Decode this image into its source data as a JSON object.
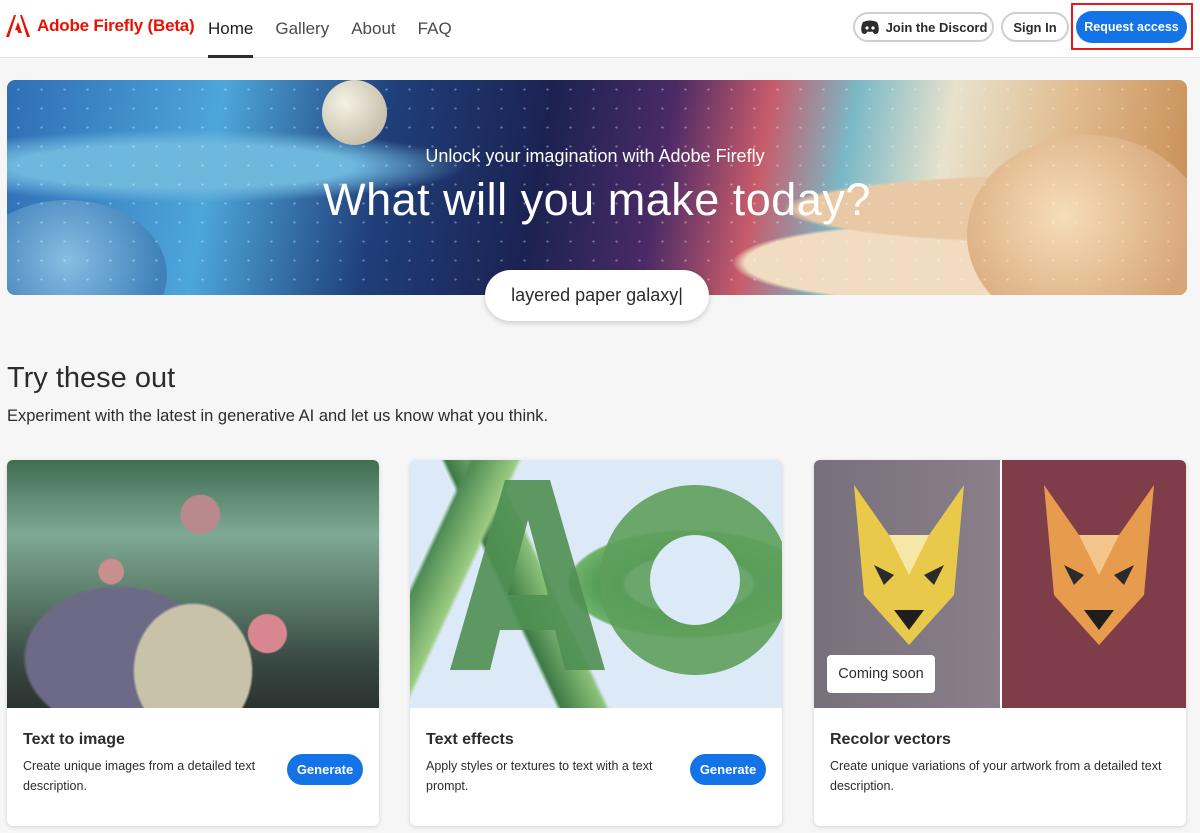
{
  "app": {
    "brand": "Adobe Firefly (Beta)",
    "colors": {
      "accent": "#1473e6",
      "brand": "#eb1000",
      "highlight": "#e8191a"
    }
  },
  "nav": {
    "items": [
      {
        "label": "Home",
        "active": true
      },
      {
        "label": "Gallery",
        "active": false
      },
      {
        "label": "About",
        "active": false
      },
      {
        "label": "FAQ",
        "active": false
      }
    ]
  },
  "header_actions": {
    "discord_label": "Join the Discord",
    "signin_label": "Sign In",
    "request_label": "Request access"
  },
  "hero": {
    "subtitle": "Unlock your imagination with Adobe Firefly",
    "title": "What will you make today?",
    "prompt_text": "layered paper galaxy|"
  },
  "section": {
    "title": "Try these out",
    "description": "Experiment with the latest in generative AI and let us know what you think."
  },
  "cards": [
    {
      "title": "Text to image",
      "description": "Create unique images from a detailed text description.",
      "button": "Generate"
    },
    {
      "title": "Text effects",
      "description": "Apply styles or textures to text with a text prompt.",
      "button": "Generate"
    },
    {
      "title": "Recolor vectors",
      "description": "Create unique variations of your artwork from a detailed text description.",
      "badge": "Coming soon"
    }
  ]
}
